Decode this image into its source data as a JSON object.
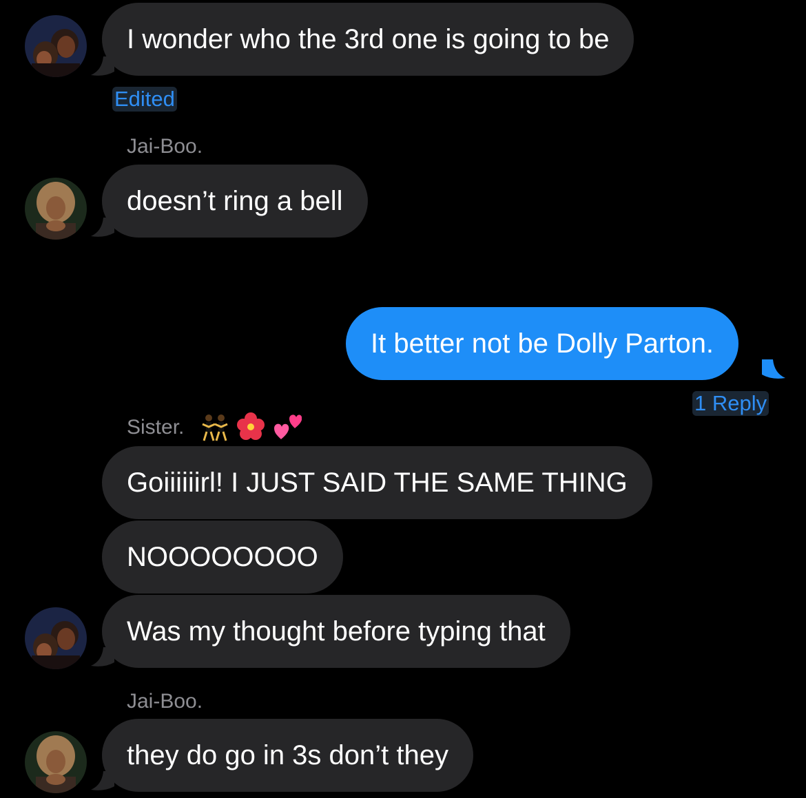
{
  "colors": {
    "background": "#000000",
    "incoming_bubble": "#262628",
    "outgoing_bubble": "#1e8ef8",
    "link_blue": "#2f8ef4",
    "sender_gray": "#8e8e93"
  },
  "messages": [
    {
      "text": "I wonder who the 3rd one is going to be",
      "direction": "incoming",
      "avatar": "avatar-sister"
    },
    {
      "text": "doesn’t ring a bell",
      "direction": "incoming",
      "sender": "Jai-Boo.",
      "avatar": "avatar-jai-boo"
    },
    {
      "text": "It better not be Dolly Parton.",
      "direction": "outgoing"
    },
    {
      "text": "Goiiiiiirl! I JUST SAID THE SAME THING",
      "direction": "incoming",
      "sender": "Sister."
    },
    {
      "text": "NOOOOOOOO",
      "direction": "incoming"
    },
    {
      "text": "Was my thought before typing that",
      "direction": "incoming",
      "avatar": "avatar-sister"
    },
    {
      "text": "they do go in 3s don’t they",
      "direction": "incoming",
      "sender": "Jai-Boo.",
      "avatar": "avatar-jai-boo"
    }
  ],
  "edited_label": "Edited",
  "reply_count_label": "1 Reply",
  "senders": {
    "jai_boo": "Jai-Boo.",
    "sister": "Sister."
  },
  "sister_name_emojis": [
    "dancing-women-icon",
    "hibiscus-icon",
    "two-hearts-icon"
  ]
}
